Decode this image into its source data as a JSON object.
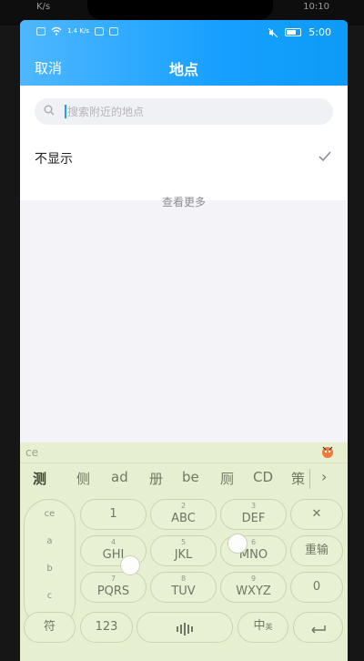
{
  "device": {
    "outer_status_left": "K/s",
    "outer_status_right": "10:10"
  },
  "statusbar": {
    "speed": "1.4 K/s",
    "time": "5:00"
  },
  "nav": {
    "cancel_label": "取消",
    "title": "地点"
  },
  "search": {
    "placeholder": "搜索附近的地点"
  },
  "options": {
    "hide_label": "不显示",
    "hide_selected": true
  },
  "more_label": "查看更多",
  "keyboard": {
    "composition": "ce",
    "candidates": [
      "测",
      "侧",
      "ad",
      "册",
      "be",
      "厕",
      "CD",
      "策"
    ],
    "left_column": [
      "ce",
      "a",
      "b",
      "c"
    ],
    "keys": [
      {
        "num": "",
        "main": "1"
      },
      {
        "num": "2",
        "main": "ABC"
      },
      {
        "num": "3",
        "main": "DEF"
      },
      {
        "num": "",
        "main": "✕"
      },
      {
        "num": "4",
        "main": "GHI"
      },
      {
        "num": "5",
        "main": "JKL"
      },
      {
        "num": "6",
        "main": "MNO"
      },
      {
        "num": "",
        "main": "重输"
      },
      {
        "num": "7",
        "main": "PQRS"
      },
      {
        "num": "8",
        "main": "TUV"
      },
      {
        "num": "9",
        "main": "WXYZ"
      },
      {
        "num": "",
        "main": "0"
      }
    ],
    "bottom": {
      "symbol": "符",
      "numbers": "123",
      "lang_main": "中",
      "lang_sub": "英"
    }
  },
  "colors": {
    "appbar_start": "#4fb7ff",
    "appbar_end": "#0d9bf7",
    "keyboard_bg": "#e6efcf",
    "caret": "#1aa0ff"
  }
}
